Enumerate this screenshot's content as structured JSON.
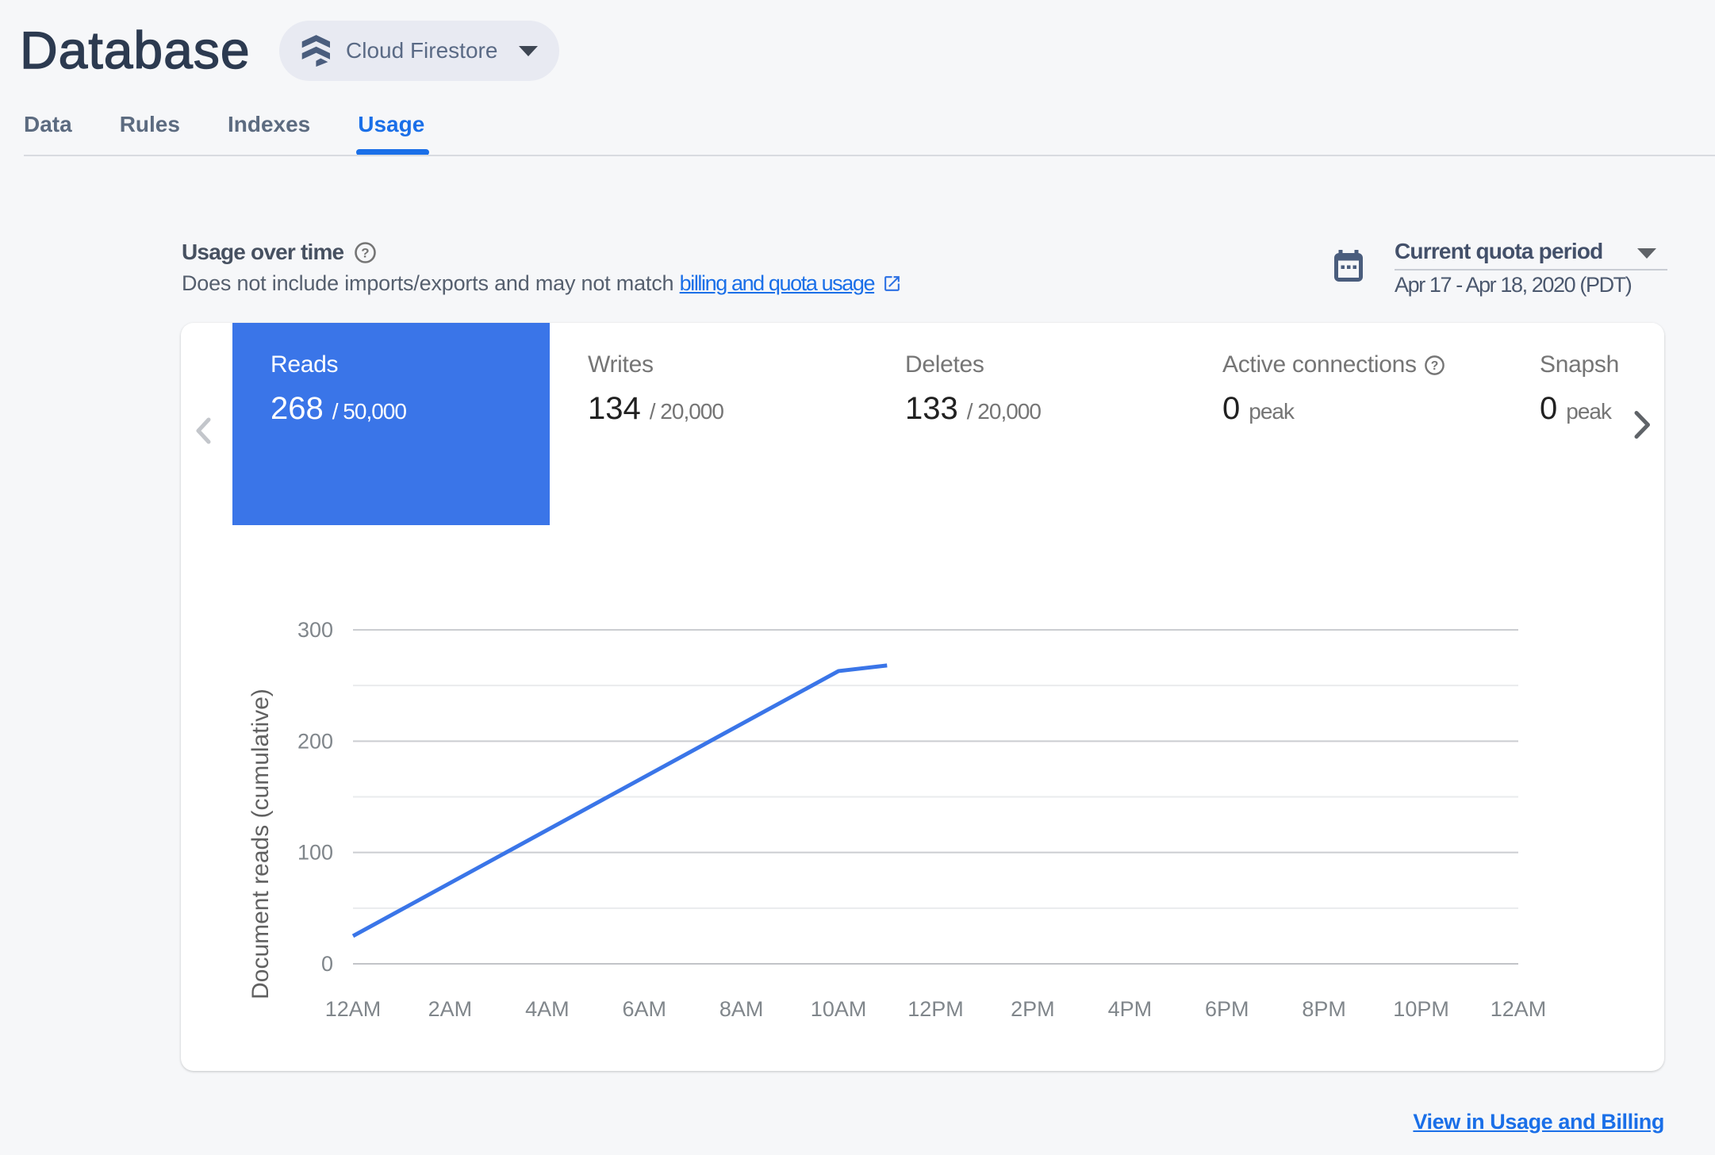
{
  "page": {
    "title": "Database"
  },
  "product_selector": {
    "label": "Cloud Firestore"
  },
  "tabs": [
    {
      "label": "Data",
      "active": false
    },
    {
      "label": "Rules",
      "active": false
    },
    {
      "label": "Indexes",
      "active": false
    },
    {
      "label": "Usage",
      "active": true
    }
  ],
  "usage_header": {
    "title": "Usage over time",
    "description_prefix": "Does not include imports/exports and may not match ",
    "link_label": "billing and quota usage"
  },
  "period_selector": {
    "label": "Current quota period",
    "value": "Apr 17 - Apr 18, 2020 (PDT)"
  },
  "metrics": [
    {
      "label": "Reads",
      "value": "268",
      "suffix": "/ 50,000",
      "selected": true,
      "help": false
    },
    {
      "label": "Writes",
      "value": "134",
      "suffix": "/ 20,000",
      "selected": false,
      "help": false
    },
    {
      "label": "Deletes",
      "value": "133",
      "suffix": "/ 20,000",
      "selected": false,
      "help": false
    },
    {
      "label": "Active connections",
      "value": "0",
      "suffix": "peak",
      "selected": false,
      "help": true
    },
    {
      "label": "Snapshot listeners",
      "value": "0",
      "suffix": "peak",
      "selected": false,
      "help": false
    }
  ],
  "footer": {
    "link_label": "View in Usage and Billing"
  },
  "colors": {
    "accent_blue": "#1a6fe8",
    "selected_tab_blue": "#3a75e8",
    "slate": "#4a5d7d",
    "page_background": "#f6f7f9"
  },
  "chart_data": {
    "type": "line",
    "title": "",
    "xlabel": "",
    "ylabel": "Document reads (cumulative)",
    "x_tick_labels": [
      "12AM",
      "2AM",
      "4AM",
      "6AM",
      "8AM",
      "10AM",
      "12PM",
      "2PM",
      "4PM",
      "6PM",
      "8PM",
      "10PM",
      "12AM"
    ],
    "x_hours_domain": [
      0,
      24
    ],
    "ylim": [
      0,
      300
    ],
    "y_tick_labels": [
      0,
      100,
      200,
      300
    ],
    "grid_step_minor": 50,
    "legend": "none",
    "series": [
      {
        "name": "Document reads (cumulative)",
        "points_hour_value": [
          [
            0,
            25
          ],
          [
            10,
            263
          ],
          [
            11,
            268
          ]
        ]
      }
    ],
    "line_color": "#3a75e8"
  }
}
